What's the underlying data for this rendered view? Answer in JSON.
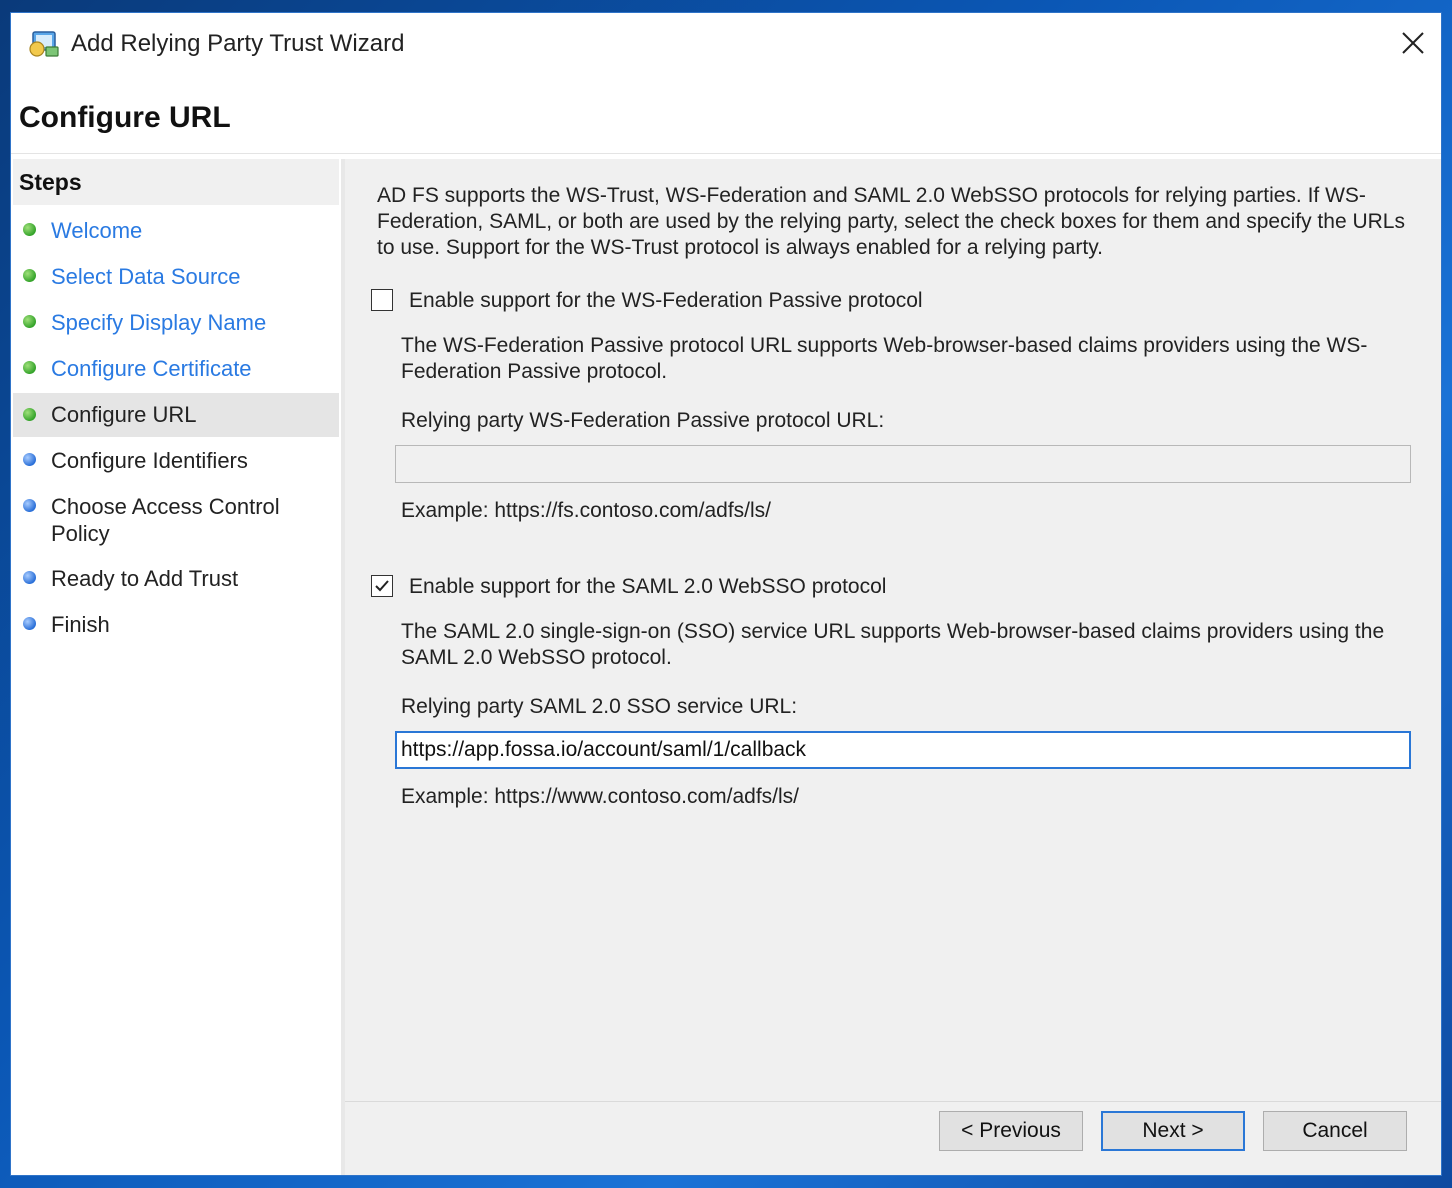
{
  "window": {
    "title": "Add Relying Party Trust Wizard",
    "page_title": "Configure URL"
  },
  "steps": {
    "heading": "Steps",
    "items": [
      {
        "label": "Welcome",
        "status": "complete"
      },
      {
        "label": "Select Data Source",
        "status": "complete"
      },
      {
        "label": "Specify Display Name",
        "status": "complete"
      },
      {
        "label": "Configure Certificate",
        "status": "complete"
      },
      {
        "label": "Configure URL",
        "status": "current"
      },
      {
        "label": "Configure Identifiers",
        "status": "pending"
      },
      {
        "label": "Choose Access Control Policy",
        "status": "pending"
      },
      {
        "label": "Ready to Add Trust",
        "status": "pending"
      },
      {
        "label": "Finish",
        "status": "pending"
      }
    ]
  },
  "main": {
    "intro": "AD FS supports the WS-Trust, WS-Federation and SAML 2.0 WebSSO protocols for relying parties.  If WS-Federation, SAML, or both are used by the relying party, select the check boxes for them and specify the URLs to use.  Support for the WS-Trust protocol is always enabled for a relying party.",
    "wsfed": {
      "checkbox_label": "Enable support for the WS-Federation Passive protocol",
      "checked": false,
      "description": "The WS-Federation Passive protocol URL supports Web-browser-based claims providers using the WS-Federation Passive protocol.",
      "field_label": "Relying party WS-Federation Passive protocol URL:",
      "value": "",
      "example": "Example: https://fs.contoso.com/adfs/ls/"
    },
    "saml": {
      "checkbox_label": "Enable support for the SAML 2.0 WebSSO protocol",
      "checked": true,
      "description": "The SAML 2.0 single-sign-on (SSO) service URL supports Web-browser-based claims providers using the SAML 2.0 WebSSO protocol.",
      "field_label": "Relying party SAML 2.0 SSO service URL:",
      "value": "https://app.fossa.io/account/saml/1/callback",
      "example": "Example: https://www.contoso.com/adfs/ls/"
    }
  },
  "buttons": {
    "previous": "< Previous",
    "next": "Next >",
    "cancel": "Cancel"
  },
  "colors": {
    "accent": "#2a77d6",
    "link": "#2a7ae2",
    "complete_dot": "#34a32a",
    "pending_dot": "#2a6fd8"
  },
  "icons": {
    "app": "relying-party-wizard-icon",
    "close": "close-icon",
    "check": "checkmark-icon"
  }
}
